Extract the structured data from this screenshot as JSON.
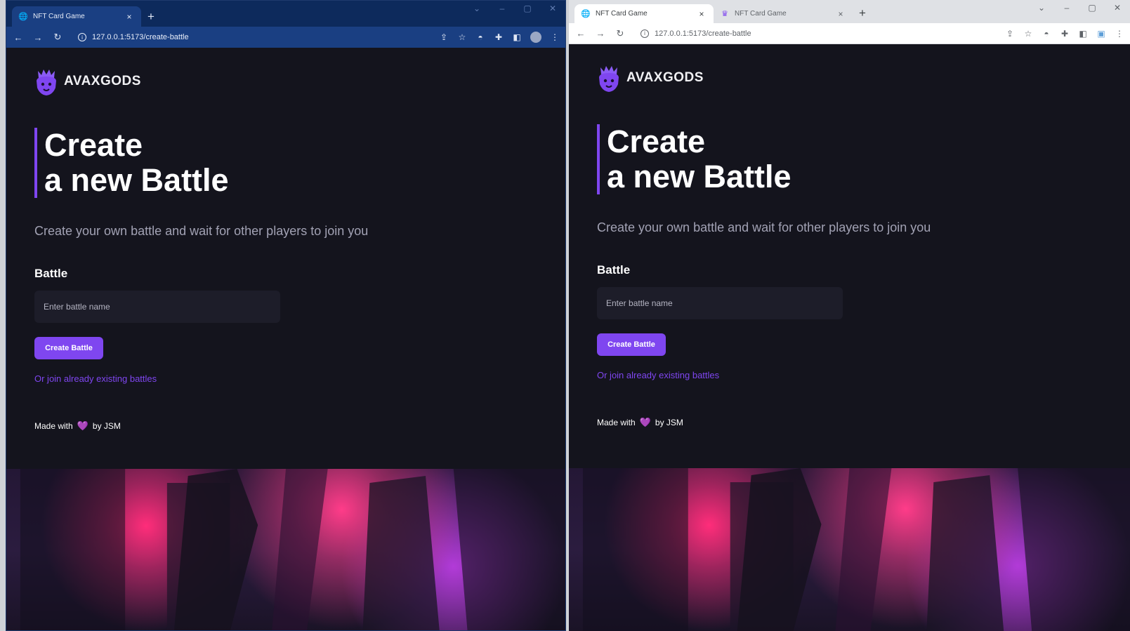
{
  "windows": [
    {
      "tabs": [
        {
          "title": "NFT Card Game",
          "close": "×"
        }
      ],
      "new_tab": "+",
      "window_controls": [
        "⌄",
        "–",
        "▢",
        "✕"
      ],
      "nav": {
        "back": "←",
        "forward": "→",
        "reload": "↻"
      },
      "url": "127.0.0.1:5173/create-battle",
      "page": {
        "brand": "AVAXGODS",
        "heading_line1": "Create",
        "heading_line2": "a new Battle",
        "subtitle": "Create your own battle and wait for other players to join you",
        "label": "Battle",
        "input_placeholder": "Enter battle name",
        "button": "Create Battle",
        "link": "Or join already existing battles",
        "footer_prefix": "Made with",
        "footer_suffix": "by JSM"
      }
    },
    {
      "tabs": [
        {
          "title": "NFT Card Game",
          "close": "×"
        },
        {
          "title": "NFT Card Game",
          "close": "×"
        }
      ],
      "new_tab": "+",
      "window_controls": [
        "⌄",
        "–",
        "▢",
        "✕"
      ],
      "nav": {
        "back": "←",
        "forward": "→",
        "reload": "↻"
      },
      "url": "127.0.0.1:5173/create-battle",
      "page": {
        "brand": "AVAXGODS",
        "heading_line1": "Create",
        "heading_line2": "a new Battle",
        "subtitle": "Create your own battle and wait for other players to join you",
        "label": "Battle",
        "input_placeholder": "Enter battle name",
        "button": "Create Battle",
        "link": "Or join already existing battles",
        "footer_prefix": "Made with",
        "footer_suffix": "by JSM"
      }
    }
  ],
  "icons": {
    "favicon": "globe-icon",
    "heart": "💜",
    "toolbar_left": [
      "share-icon",
      "star-icon",
      "extension-cat-icon",
      "puzzle-icon",
      "sidepanel-icon",
      "profile-avatar-icon",
      "kebab-menu-icon"
    ]
  },
  "colors": {
    "accent": "#7f46f0",
    "page_bg": "#14141d",
    "input_bg": "#1d1d29",
    "subtitle": "#a2a2b4"
  }
}
